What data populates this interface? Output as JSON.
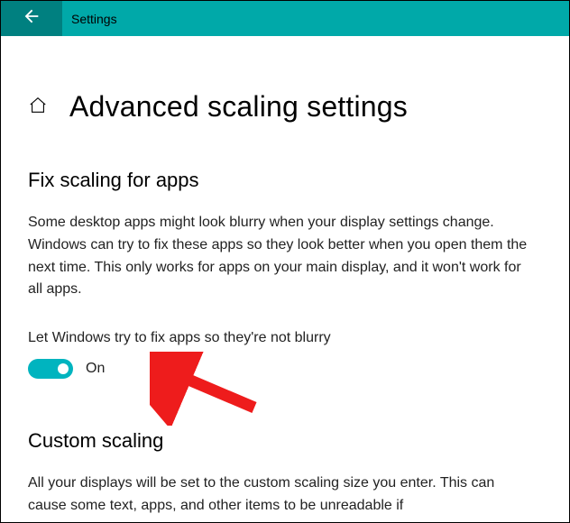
{
  "header": {
    "title": "Settings"
  },
  "page": {
    "title": "Advanced scaling settings"
  },
  "section1": {
    "title": "Fix scaling for apps",
    "body": "Some desktop apps might look blurry when your display settings change. Windows can try to fix these apps so they look better when you open them the next time. This only works for apps on your main display, and it won't work for all apps.",
    "toggle_label": "Let Windows try to fix apps so they're not blurry",
    "toggle_state": "On"
  },
  "section2": {
    "title": "Custom scaling",
    "body": "All your displays will be set to the custom scaling size you enter. This can cause some text, apps, and other items to be unreadable if"
  },
  "colors": {
    "accent": "#00b4bf",
    "header_bg": "#00a9a9",
    "back_bg": "#008080"
  }
}
